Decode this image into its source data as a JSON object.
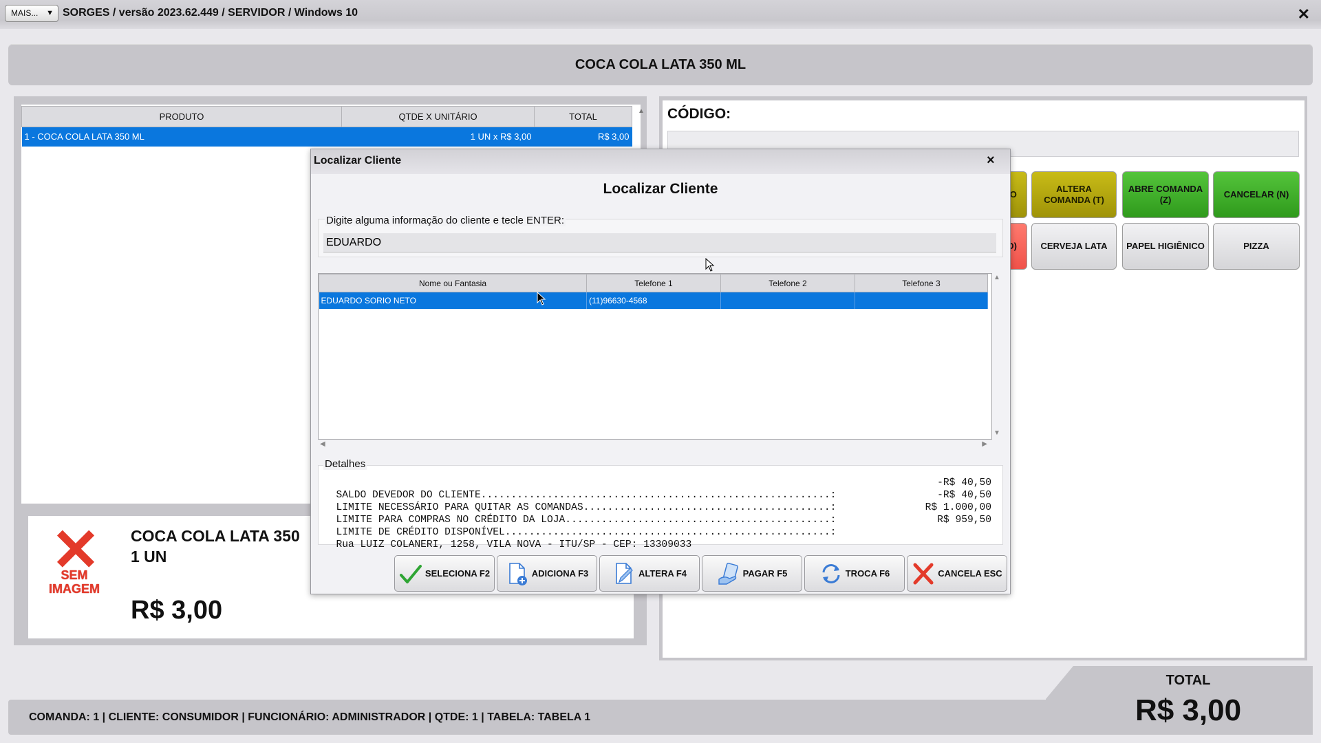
{
  "titlebar": {
    "mais_label": "MAIS...",
    "title": "SORGES / versão 2023.62.449 / SERVIDOR / Windows 10",
    "close": "✕"
  },
  "product_header": "COCA COLA LATA 350 ML",
  "items_table": {
    "headers": [
      "PRODUTO",
      "QTDE X UNITÁRIO",
      "TOTAL"
    ],
    "rows": [
      {
        "produto": "1 - COCA COLA LATA 350 ML",
        "qtde": "1 UN x R$ 3,00",
        "total": "R$ 3,00"
      }
    ]
  },
  "product_card": {
    "image_placeholder": "SEM IMAGEM",
    "name": "COCA COLA LATA 350",
    "qty": "1  UN",
    "price": "R$ 3,00"
  },
  "right_panel": {
    "codigo_label": "CÓDIGO:",
    "buttons_row1": [
      "TO",
      "ALTERA COMANDA (T)",
      "ABRE COMANDA (Z)",
      "CANCELAR (N)"
    ],
    "buttons_row2": [
      "(D)",
      "CERVEJA LATA",
      "PAPEL HIGIÊNICO",
      "PIZZA"
    ]
  },
  "modal": {
    "title": "Localizar Cliente",
    "heading": "Localizar Cliente",
    "close": "×",
    "search_label": "Digite alguma informação do cliente e tecle ENTER:",
    "search_value": "EDUARDO",
    "grid_headers": [
      "Nome ou Fantasia",
      "Telefone 1",
      "Telefone 2",
      "Telefone 3"
    ],
    "grid_rows": [
      {
        "nome": "EDUARDO SORIO NETO",
        "tel1": "(11)96630-4568",
        "tel2": "",
        "tel3": ""
      }
    ],
    "details_label": "Detalhes",
    "details": [
      {
        "label": "SALDO DEVEDOR DO CLIENTE..........................................................:",
        "value": "-R$ 40,50"
      },
      {
        "label": "LIMITE NECESSÁRIO PARA QUITAR AS COMANDAS.........................................:",
        "value": "-R$ 40,50"
      },
      {
        "label": "LIMITE PARA COMPRAS NO CRÉDITO DA LOJA............................................:",
        "value": "R$ 1.000,00"
      },
      {
        "label": "LIMITE DE CRÉDITO DISPONÍVEL......................................................:",
        "value": "R$ 959,50"
      },
      {
        "label": "Rua LUIZ COLANERI, 1258, VILA NOVA - ITU/SP - CEP: 13309033",
        "value": ""
      }
    ],
    "buttons": [
      "SELECIONA F2",
      "ADICIONA F3",
      "ALTERA F4",
      "PAGAR F5",
      "TROCA F6",
      "CANCELA ESC"
    ]
  },
  "status_bar": "COMANDA: 1  |  CLIENTE: CONSUMIDOR  |  FUNCIONÁRIO: ADMINISTRADOR  |  QTDE: 1  |  TABELA: TABELA 1",
  "total": {
    "label": "TOTAL",
    "value": "R$ 3,00"
  }
}
